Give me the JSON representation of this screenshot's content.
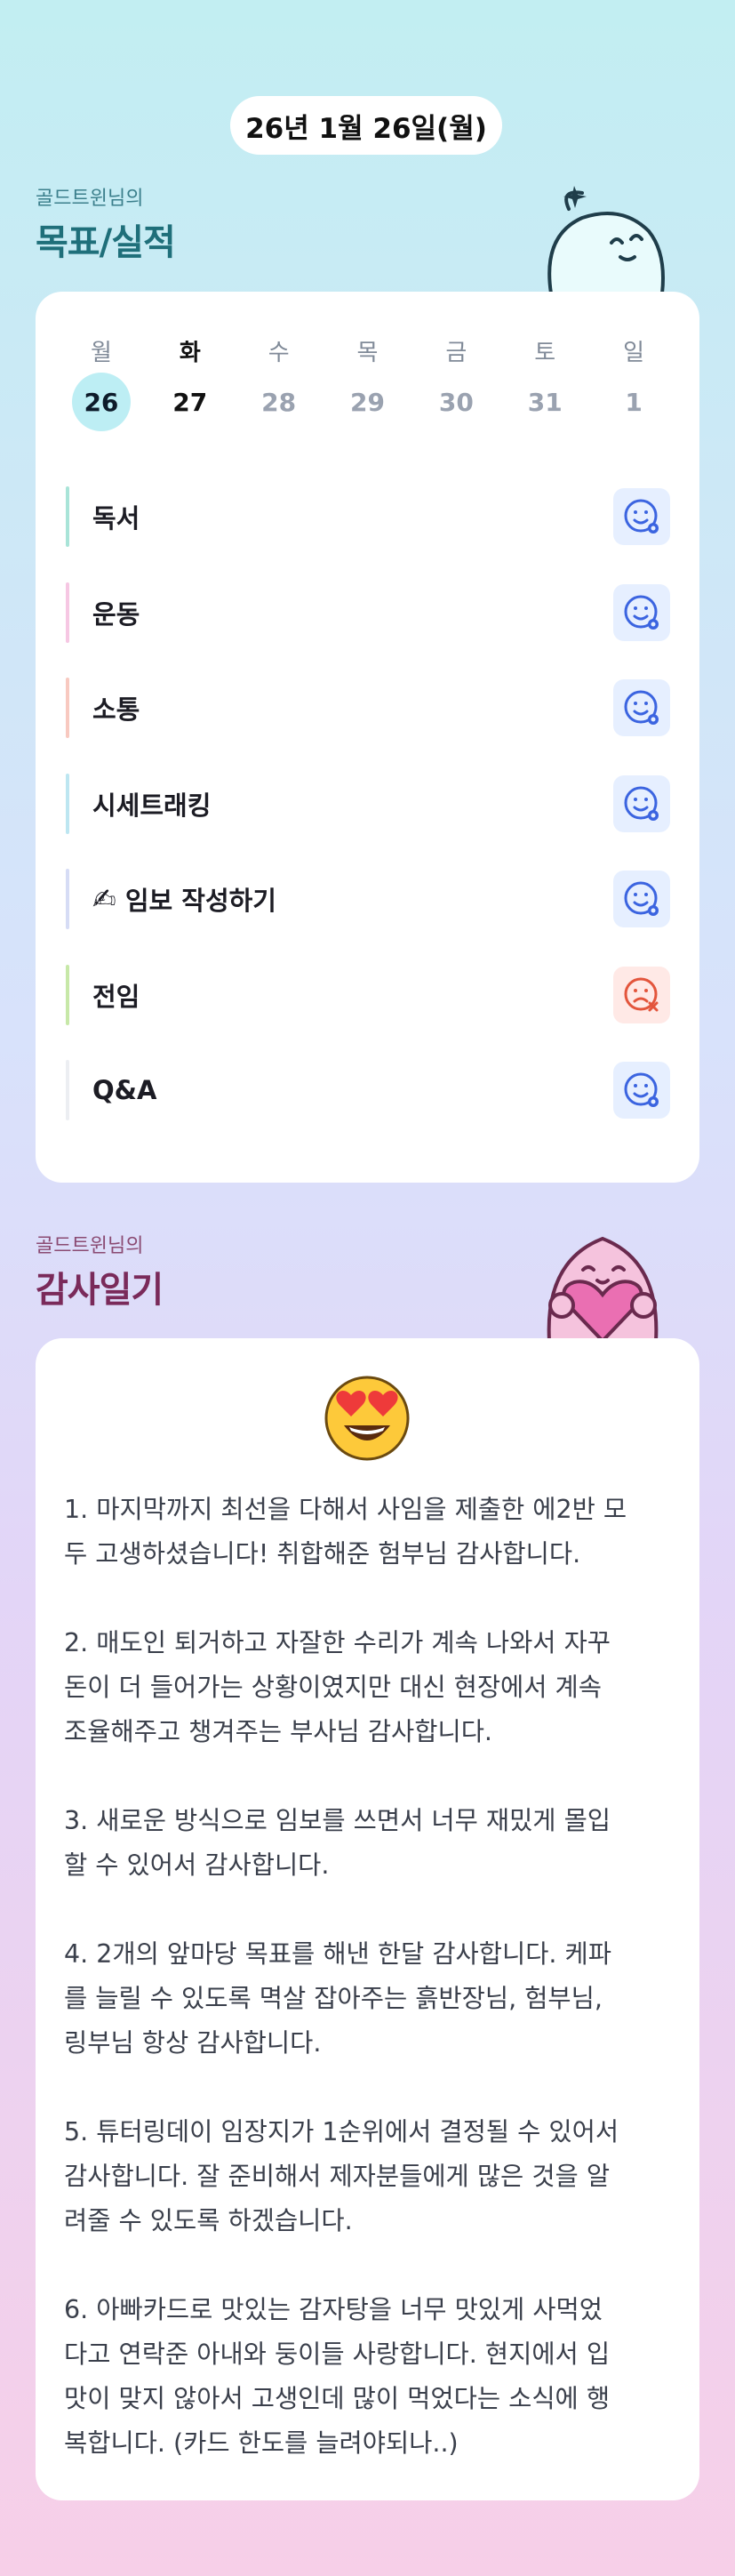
{
  "header": {
    "date": "26년 1월 26일(월)"
  },
  "goals_section": {
    "subtitle": "골드트윈님의",
    "title": "목표/실적"
  },
  "week": {
    "days": [
      "월",
      "화",
      "수",
      "목",
      "금",
      "토",
      "일"
    ],
    "dates": [
      "26",
      "27",
      "28",
      "29",
      "30",
      "31",
      "1"
    ]
  },
  "goals": [
    {
      "label": "독서",
      "bar_color": "#a9e4d8",
      "status": "smile-icon"
    },
    {
      "label": "운동",
      "bar_color": "#f6c7e3",
      "status": "smile-icon"
    },
    {
      "label": "소통",
      "bar_color": "#f8c9c0",
      "status": "smile-icon"
    },
    {
      "label": "시세트래킹",
      "bar_color": "#bde6f1",
      "status": "smile-icon"
    },
    {
      "label": "임보 작성하기",
      "bar_color": "#d6dcf5",
      "status": "smile-icon"
    },
    {
      "label": "전임",
      "bar_color": "#c7e8a8",
      "status": "sad-x-icon"
    },
    {
      "label": "Q&A",
      "bar_color": "#eceef2",
      "status": "smile-icon"
    }
  ],
  "diary_section": {
    "subtitle": "골드트윈님의",
    "title": "감사일기"
  },
  "diary": {
    "emoji": "heart-eyes-icon",
    "entries": [
      "1. 마지막까지 최선을 다해서 사임을 제출한 에2반 모\n두 고생하셨습니다! 취합해준 험부님 감사합니다.",
      "2. 매도인 퇴거하고 자잘한 수리가 계속 나와서 자꾸\n돈이 더 들어가는 상황이였지만 대신 현장에서 계속\n조율해주고 챙겨주는 부사님 감사합니다.",
      "3. 새로운 방식으로 임보를 쓰면서 너무 재밌게 몰입\n할 수 있어서 감사합니다.",
      "4. 2개의 앞마당 목표를 해낸 한달 감사합니다. 케파\n를 늘릴 수 있도록 멱살 잡아주는 흙반장님, 험부님,\n링부님 항상 감사합니다.",
      "5. 튜터링데이 임장지가 1순위에서 결정될 수 있어서\n감사합니다. 잘 준비해서 제자분들에게 많은 것을 알\n려줄 수 있도록 하겠습니다.",
      "6. 아빠카드로 맛있는 감자탕을 너무 맛있게 사먹었\n다고 연락준 아내와 둥이들 사랑합니다. 현지에서 입\n맛이 맞지 않아서 고생인데 많이 먹었다는 소식에 행\n복합니다. (카드 한도를 늘려야되나..)"
    ]
  },
  "colors": {
    "title_teal": "#1f6f7a",
    "title_plum": "#7a2a5a",
    "smile_blue": "#3b64e0",
    "sad_red": "#e3553c"
  }
}
